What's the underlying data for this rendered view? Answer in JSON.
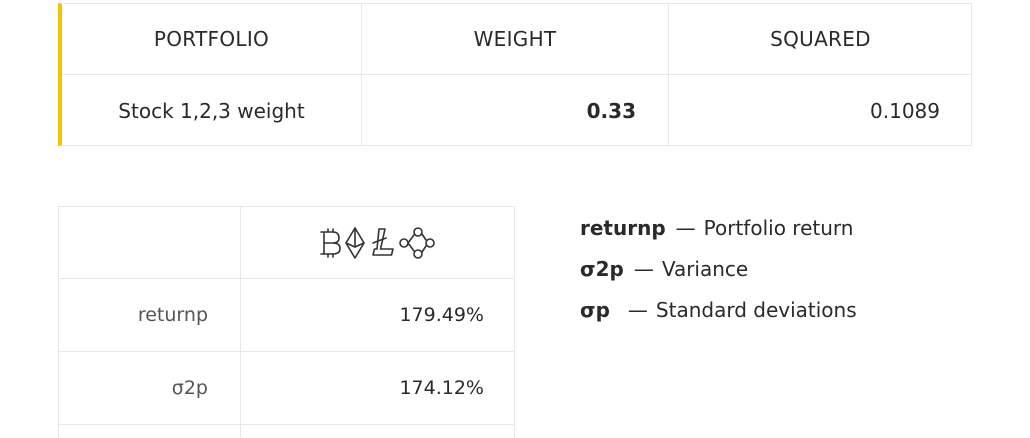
{
  "portfolio_table": {
    "headers": [
      "PORTFOLIO",
      "WEIGHT",
      "SQUARED"
    ],
    "row": {
      "portfolio": "Stock 1,2,3 weight",
      "weight": "0.33",
      "squared": "0.1089"
    },
    "accent_color": "#f5c400"
  },
  "metrics_table": {
    "header_icons": [
      "bitcoin-icon",
      "ethereum-icon",
      "litecoin-icon",
      "ripple-icon"
    ],
    "rows": [
      {
        "label": "returnp",
        "value": "179.49%"
      },
      {
        "label": "σ2p",
        "value": "174.12%"
      }
    ]
  },
  "legend": [
    {
      "term": "returnp",
      "dash": "—",
      "desc": "Portfolio return"
    },
    {
      "term": "σ2p",
      "dash": "—",
      "desc": "Variance"
    },
    {
      "term": "σp",
      "dash": "—",
      "desc": "Standard deviations"
    }
  ]
}
